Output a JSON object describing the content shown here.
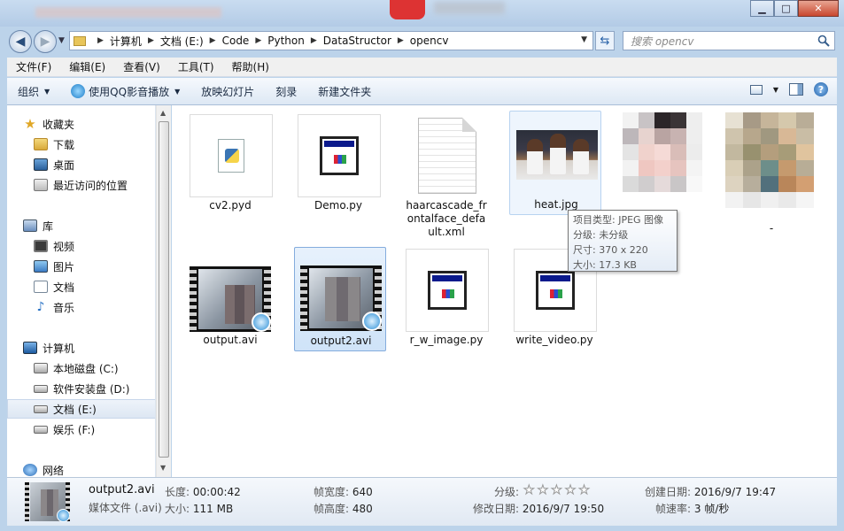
{
  "window": {
    "minimize": "▁",
    "maximize": "□",
    "close": "✕"
  },
  "address": {
    "crumbs": [
      "计算机",
      "文档 (E:)",
      "Code",
      "Python",
      "DataStructor",
      "opencv"
    ],
    "search_placeholder": "搜索 opencv"
  },
  "menu": [
    "文件(F)",
    "编辑(E)",
    "查看(V)",
    "工具(T)",
    "帮助(H)"
  ],
  "toolbar": {
    "organize": "组织",
    "play_qq": "使用QQ影音播放",
    "slideshow": "放映幻灯片",
    "burn": "刻录",
    "new_folder": "新建文件夹"
  },
  "nav": {
    "favorites": "收藏夹",
    "downloads": "下载",
    "desktop": "桌面",
    "recent": "最近访问的位置",
    "libraries": "库",
    "videos": "视频",
    "pictures": "图片",
    "documents": "文档",
    "music": "音乐",
    "computer": "计算机",
    "drive_c": "本地磁盘 (C:)",
    "drive_d": "软件安装盘 (D:)",
    "drive_e": "文档 (E:)",
    "drive_f": "娱乐 (F:)",
    "network": "网络"
  },
  "files": {
    "cv2": "cv2.pyd",
    "demo": "Demo.py",
    "haar": "haarcascade_frontalface_default.xml",
    "heat": "heat.jpg",
    "output": "output.avi",
    "output2": "output2.avi",
    "rw": "r_w_image.py",
    "write": "write_video.py",
    "dash": "-"
  },
  "tooltip": {
    "type": "项目类型: JPEG 图像",
    "rating": "分级: 未分级",
    "size": "尺寸: 370 x 220",
    "filesize": "大小: 17.3 KB"
  },
  "details": {
    "name": "output2.avi",
    "type": "媒体文件 (.avi)",
    "length_label": "长度:",
    "length": "00:00:42",
    "size_label": "大小:",
    "size": "111 MB",
    "width_label": "帧宽度:",
    "width": "640",
    "height_label": "帧高度:",
    "height": "480",
    "rating_label": "分级:",
    "rating_stars": 0,
    "modified_label": "修改日期:",
    "modified": "2016/9/7 19:50",
    "created_label": "创建日期:",
    "created": "2016/9/7 19:47",
    "framerate_label": "帧速率:",
    "framerate": "3 帧/秒"
  }
}
